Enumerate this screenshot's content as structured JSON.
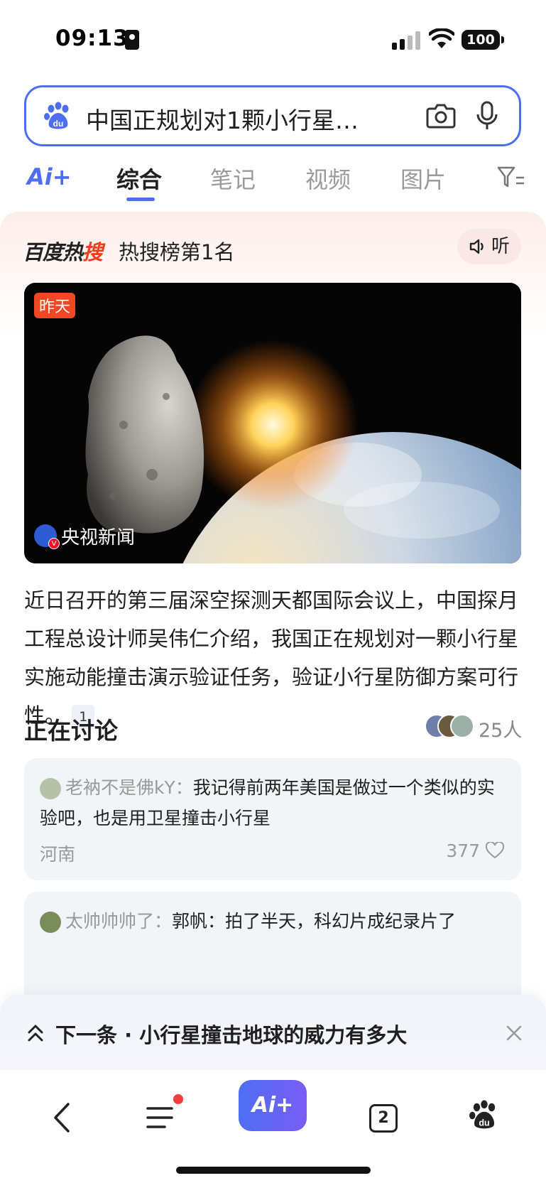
{
  "status_bar": {
    "time": "09:13",
    "battery": "100"
  },
  "search": {
    "query": "中国正规划对1颗小行星…"
  },
  "tabs": {
    "ai_label": "Ai+",
    "items": [
      {
        "label": "综合",
        "active": true
      },
      {
        "label": "笔记",
        "active": false
      },
      {
        "label": "视频",
        "active": false
      },
      {
        "label": "图片",
        "active": false
      }
    ]
  },
  "hot": {
    "logo_part1": "百度热",
    "logo_part2": "搜",
    "rank": "热搜榜第1名",
    "listen_label": "听",
    "image_tag": "昨天",
    "source": "央视新闻",
    "summary": "近日召开的第三届深空探测天都国际会议上，中国探月工程总设计师吴伟仁介绍，我国正在规划对一颗小行星实施动能撞击演示验证任务，验证小行星防御方案可行性。",
    "ref_num": "1"
  },
  "discussion": {
    "title": "正在讨论",
    "count": "25人",
    "comments": [
      {
        "user": "老衲不是佛kY：",
        "text": "我记得前两年美国是做过一个类似的实验吧，也是用卫星撞击小行星",
        "location": "河南",
        "likes": "377"
      },
      {
        "user": "太帅帅帅了：",
        "text": "郭帆：拍了半天，科幻片成纪录片了",
        "location": "",
        "likes": ""
      }
    ]
  },
  "next": {
    "label": "下一条 · 小行星撞击地球的威力有多大"
  },
  "bottom_nav": {
    "ai_label": "Ai+",
    "pages_count": "2"
  },
  "colors": {
    "accent": "#4e6ef2",
    "hot_red": "#f23d1f",
    "tag_red": "#f24724"
  }
}
